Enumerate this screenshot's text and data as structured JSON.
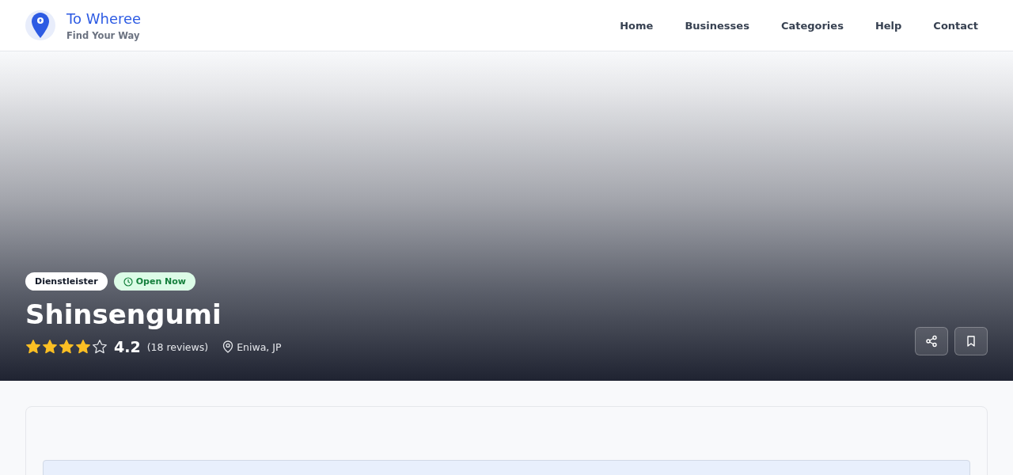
{
  "brand": {
    "name": "To Wheree",
    "tagline": "Find Your Way"
  },
  "nav": [
    "Home",
    "Businesses",
    "Categories",
    "Help",
    "Contact"
  ],
  "business": {
    "category": "Dienstleister",
    "status": {
      "label": "Open Now",
      "open": true
    },
    "name": "Shinsengumi",
    "stars": 4,
    "rating": "4.2",
    "reviews": "(18 reviews)",
    "location": "Eniwa, JP"
  }
}
